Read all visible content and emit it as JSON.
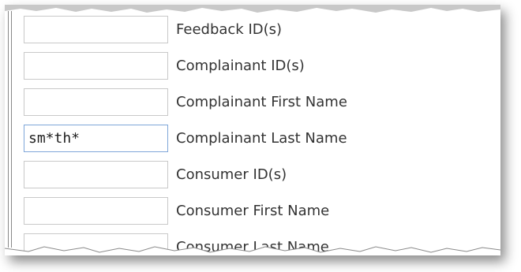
{
  "fields": [
    {
      "label": "Feedback ID(s)",
      "value": ""
    },
    {
      "label": "Complainant ID(s)",
      "value": ""
    },
    {
      "label": "Complainant First Name",
      "value": ""
    },
    {
      "label": "Complainant Last Name",
      "value": "sm*th*"
    },
    {
      "label": "Consumer ID(s)",
      "value": ""
    },
    {
      "label": "Consumer First Name",
      "value": ""
    },
    {
      "label": "Consumer Last Name",
      "value": ""
    }
  ]
}
